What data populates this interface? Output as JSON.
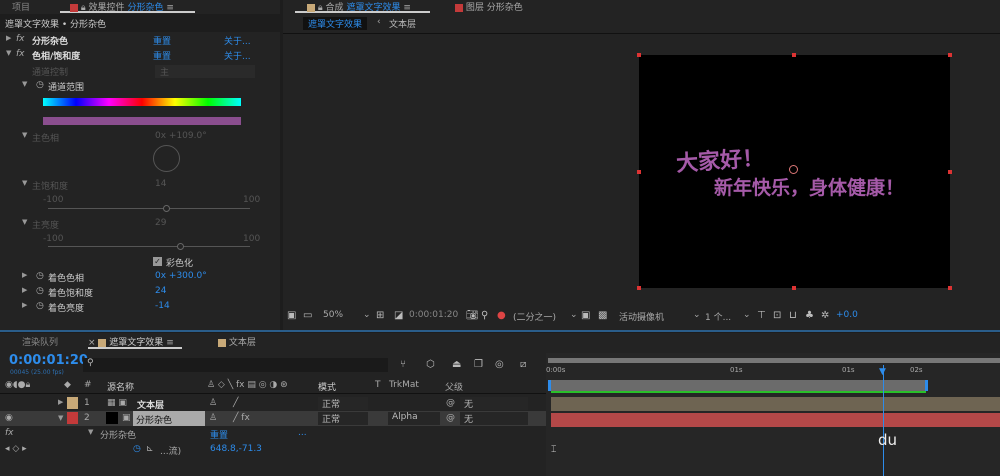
{
  "top_tabs": {
    "project": "项目",
    "effects_prefix": "效果控件",
    "effects_layer": "分形杂色",
    "comp_prefix": "合成",
    "comp_name": "遮罩文字效果",
    "layer_prefix": "图层",
    "layer_name": "分形杂色"
  },
  "effects": {
    "breadcrumb": "遮罩文字效果 • 分形杂色",
    "fx1": {
      "name": "分形杂色",
      "reset": "重置",
      "about": "关于..."
    },
    "fx2": {
      "name": "色相/饱和度",
      "reset": "重置",
      "about": "关于..."
    },
    "channel_control": {
      "label": "通道控制",
      "value": "主"
    },
    "channel_range": "通道范围",
    "master_hue": {
      "label": "主色相",
      "value": "0x +109.0°"
    },
    "master_sat": {
      "label": "主饱和度",
      "value": "14",
      "min": "-100",
      "max": "100",
      "level": 14
    },
    "master_light": {
      "label": "主亮度",
      "value": "29",
      "min": "-100",
      "max": "100",
      "level": 29
    },
    "colorize": {
      "label": "彩色化",
      "checked": true
    },
    "colorize_hue": {
      "label": "着色色相",
      "value": "0x +300.0°"
    },
    "colorize_sat": {
      "label": "着色饱和度",
      "value": "24"
    },
    "colorize_light": {
      "label": "着色亮度",
      "value": "-14"
    }
  },
  "viewer": {
    "nav": {
      "active": "遮罩文字效果",
      "other": "文本层"
    },
    "text_line1": "大家好！",
    "text_line2": "新年快乐，身体健康！",
    "toolbar": {
      "zoom": "50%",
      "timecode": "0:00:01:20",
      "resolution": "(二分之一)",
      "camera": "活动摄像机",
      "views": "1 个...",
      "exposure": "+0.0"
    }
  },
  "timeline": {
    "tabs": {
      "render_queue": "渲染队列",
      "comp": "遮罩文字效果",
      "text_layer": "文本层"
    },
    "timecode": "0:00:01:20",
    "frames": "00045 (25.00 fps)",
    "search_placeholder": "",
    "columns": {
      "num": "#",
      "source": "源名称",
      "mode": "模式",
      "t": "T",
      "trkmat": "TrkMat",
      "parent": "父级"
    },
    "layers": [
      {
        "num": "1",
        "name": "文本层",
        "mode": "正常",
        "trkmat": "",
        "parent": "无",
        "color": "#c8a978"
      },
      {
        "num": "2",
        "name": "分形杂色",
        "mode": "正常",
        "trkmat": "Alpha",
        "parent": "无",
        "color": "#c33a3a"
      }
    ],
    "effect_row": {
      "name": "分形杂色",
      "reset": "重置",
      "dots": "..."
    },
    "property_row": {
      "name": "...流)",
      "value": "648.8,-71.3"
    },
    "ruler": {
      "labels": [
        "0:00s",
        "01s",
        "01s",
        "02s"
      ],
      "cursor_label": "du"
    }
  }
}
